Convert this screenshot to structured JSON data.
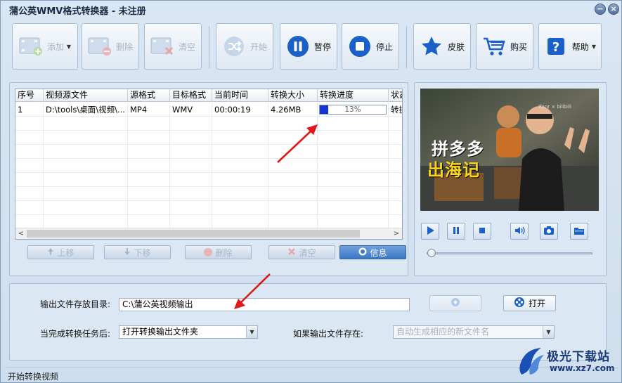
{
  "window": {
    "title": "蒲公英WMV格式转换器 - 未注册",
    "minimize_glyph": "−",
    "close_glyph": "×"
  },
  "toolbar": {
    "add": {
      "label": "添加",
      "icon": "film-add-icon",
      "has_dropdown": true
    },
    "delete": {
      "label": "删除",
      "icon": "film-remove-icon"
    },
    "clear": {
      "label": "清空",
      "icon": "film-clear-icon"
    },
    "start": {
      "label": "开始",
      "icon": "shuffle-icon"
    },
    "pause": {
      "label": "暂停",
      "icon": "pause-icon"
    },
    "stop": {
      "label": "停止",
      "icon": "stop-icon"
    },
    "skin": {
      "label": "皮肤",
      "icon": "star-icon"
    },
    "buy": {
      "label": "购买",
      "icon": "cart-icon"
    },
    "help": {
      "label": "帮助",
      "icon": "help-icon",
      "has_dropdown": true
    },
    "dropdown_glyph": "▼"
  },
  "file_table": {
    "columns": [
      "序号",
      "视频源文件",
      "源格式",
      "目标格式",
      "当前时间",
      "转换大小",
      "转换进度",
      "状态"
    ],
    "rows": [
      {
        "index": "1",
        "source": "D:\\tools\\桌面\\视频\\...",
        "src_format": "MP4",
        "target_format": "WMV",
        "current_time": "00:00:19",
        "size": "4.26MB",
        "progress_text": "13%",
        "progress": 0.13,
        "status": "转换"
      }
    ],
    "scroll_left": "<",
    "scroll_right": ">"
  },
  "list_buttons": {
    "move_up": "上移",
    "move_down": "下移",
    "delete": "删除",
    "clear": "清空",
    "info": "信息"
  },
  "preview": {
    "thumbnail_caption_line1": "拼多多",
    "thumbnail_caption_line2": "出海记",
    "channel_tag": "Ifanr × bilibili",
    "controls": [
      "play-icon",
      "pause-icon",
      "stop-icon",
      "volume-icon",
      "camera-icon",
      "folder-icon"
    ],
    "position": 0.0
  },
  "output": {
    "dir_label": "输出文件存放目录:",
    "dir_value": "C:\\蒲公英视频输出",
    "open_button": "打开",
    "after_label": "当完成转换任务后:",
    "after_value": "打开转换输出文件夹",
    "exists_label": "如果输出文件存在:",
    "exists_value": "自动生成相应的新文件名"
  },
  "status": {
    "text": "开始转换视频"
  },
  "watermark": {
    "title": "极光下载站",
    "url": "www.xz7.com"
  },
  "colors": {
    "accent": "#1a4fb5",
    "progress": "#1236d6",
    "window_bg": "#d9e6f3"
  }
}
